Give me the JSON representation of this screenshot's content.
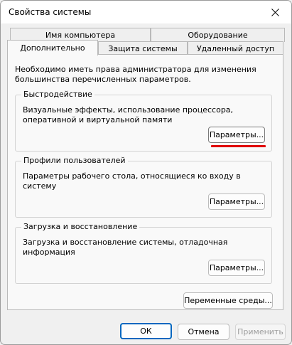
{
  "window": {
    "title": "Свойства системы"
  },
  "tabs": {
    "row1": [
      {
        "label": "Имя компьютера"
      },
      {
        "label": "Оборудование"
      }
    ],
    "row2": [
      {
        "label": "Дополнительно",
        "active": true
      },
      {
        "label": "Защита системы"
      },
      {
        "label": "Удаленный доступ"
      }
    ]
  },
  "intro_text": "Необходимо иметь права администратора для изменения большинства перечисленных параметров.",
  "groups": {
    "performance": {
      "title": "Быстродействие",
      "description": "Визуальные эффекты, использование процессора, оперативной и виртуальной памяти",
      "button": "Параметры..."
    },
    "user_profiles": {
      "title": "Профили пользователей",
      "description": "Параметры рабочего стола, относящиеся ко входу в систему",
      "button": "Параметры..."
    },
    "startup_recovery": {
      "title": "Загрузка и восстановление",
      "description": "Загрузка и восстановление системы, отладочная информация",
      "button": "Параметры..."
    }
  },
  "env_button": "Переменные среды...",
  "footer": {
    "ok": "ОК",
    "cancel": "Отмена",
    "apply": "Применить"
  },
  "colors": {
    "highlight_underline": "#e00000",
    "default_button_border": "#0067c0"
  }
}
